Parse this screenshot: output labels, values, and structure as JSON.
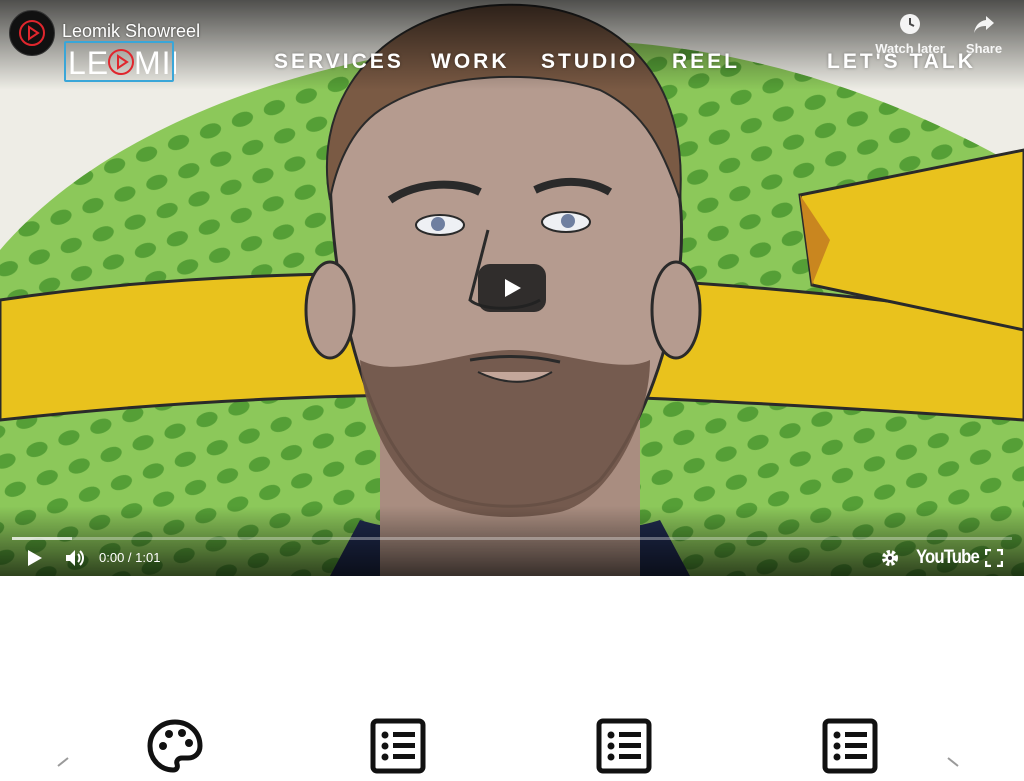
{
  "video": {
    "title": "Leomik Showreel",
    "watch_later_label": "Watch later",
    "share_label": "Share",
    "time_current": "0:00",
    "time_separator": " / ",
    "time_total": "1:01",
    "progress_buffered": 0.06,
    "player_brand": "YouTube"
  },
  "site": {
    "logo_text": "LEOMIK",
    "nav": {
      "services": "SERVICES",
      "work": "WORK",
      "studio": "STUDIO",
      "reel": "REEL",
      "talk": "LET'S TALK"
    }
  },
  "colors": {
    "accent_red": "#e0262d",
    "logo_frame": "#3aa6d8",
    "field_green": "#7cc24a",
    "ribbon_yellow": "#e9c21d"
  },
  "icons": {
    "feature_1": "palette-icon",
    "feature_2": "list-icon",
    "feature_3": "list-icon",
    "feature_4": "list-icon"
  }
}
